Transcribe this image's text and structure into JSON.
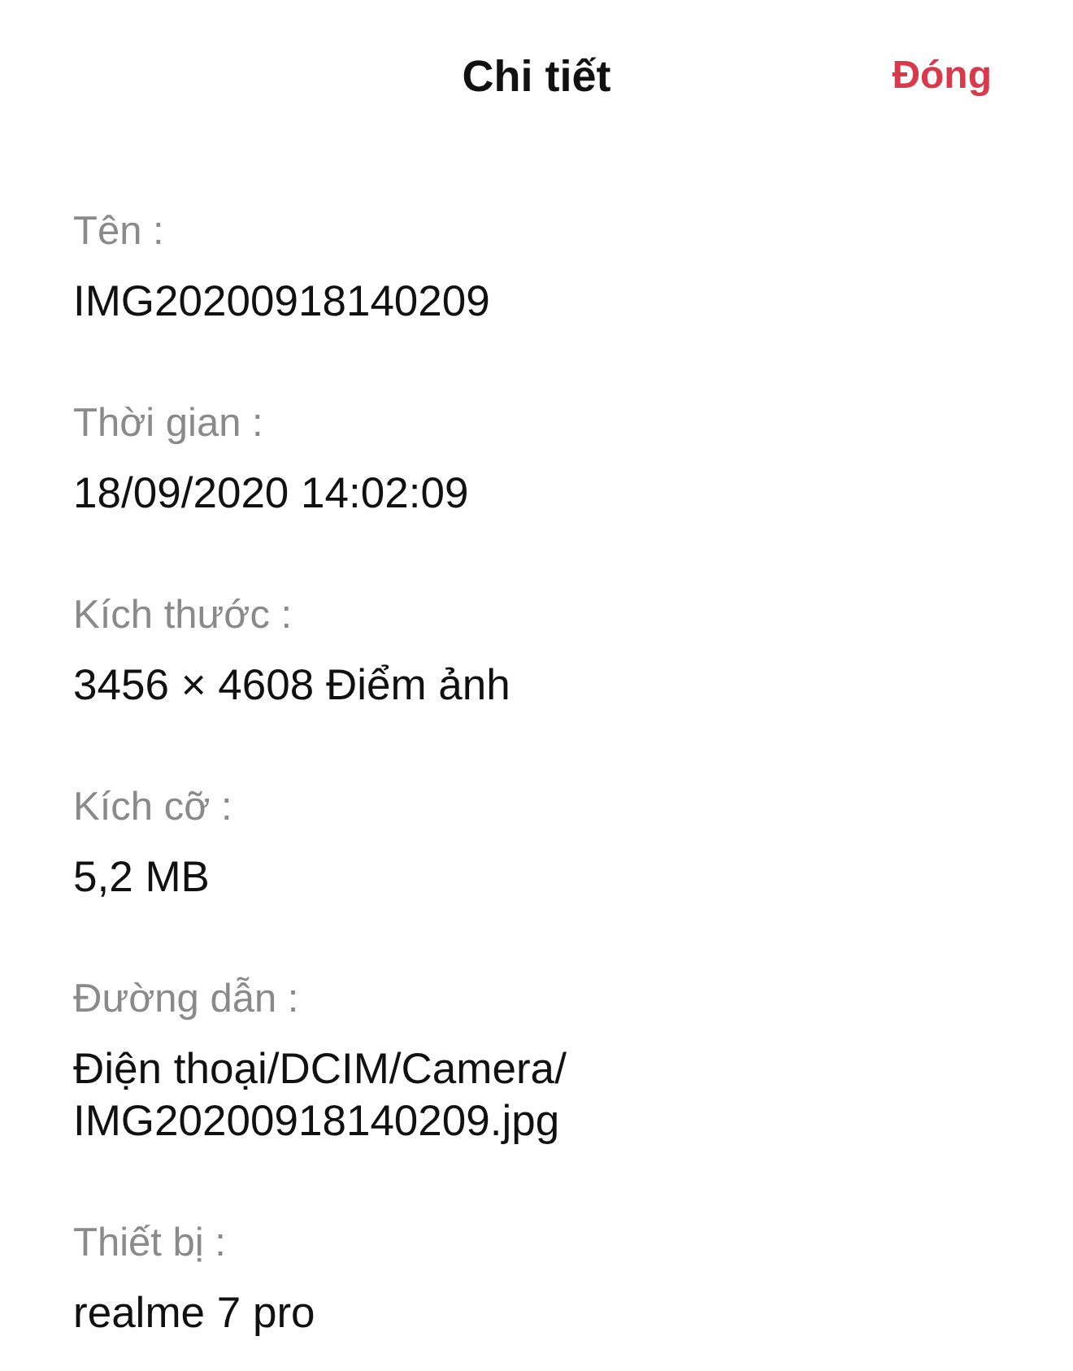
{
  "header": {
    "title": "Chi tiết",
    "close_button": "Đóng"
  },
  "fields": [
    {
      "label": "Tên :",
      "value": "IMG20200918140209"
    },
    {
      "label": "Thời gian :",
      "value": "18/09/2020 14:02:09"
    },
    {
      "label": "Kích thước :",
      "value": "3456 × 4608 Điểm ảnh"
    },
    {
      "label": "Kích cỡ :",
      "value": "5,2 MB"
    },
    {
      "label": "Đường dẫn :",
      "value": "Điện thoại/DCIM/Camera/IMG20200918140209.jpg"
    },
    {
      "label": "Thiết bị :",
      "value": "realme 7 pro"
    }
  ]
}
